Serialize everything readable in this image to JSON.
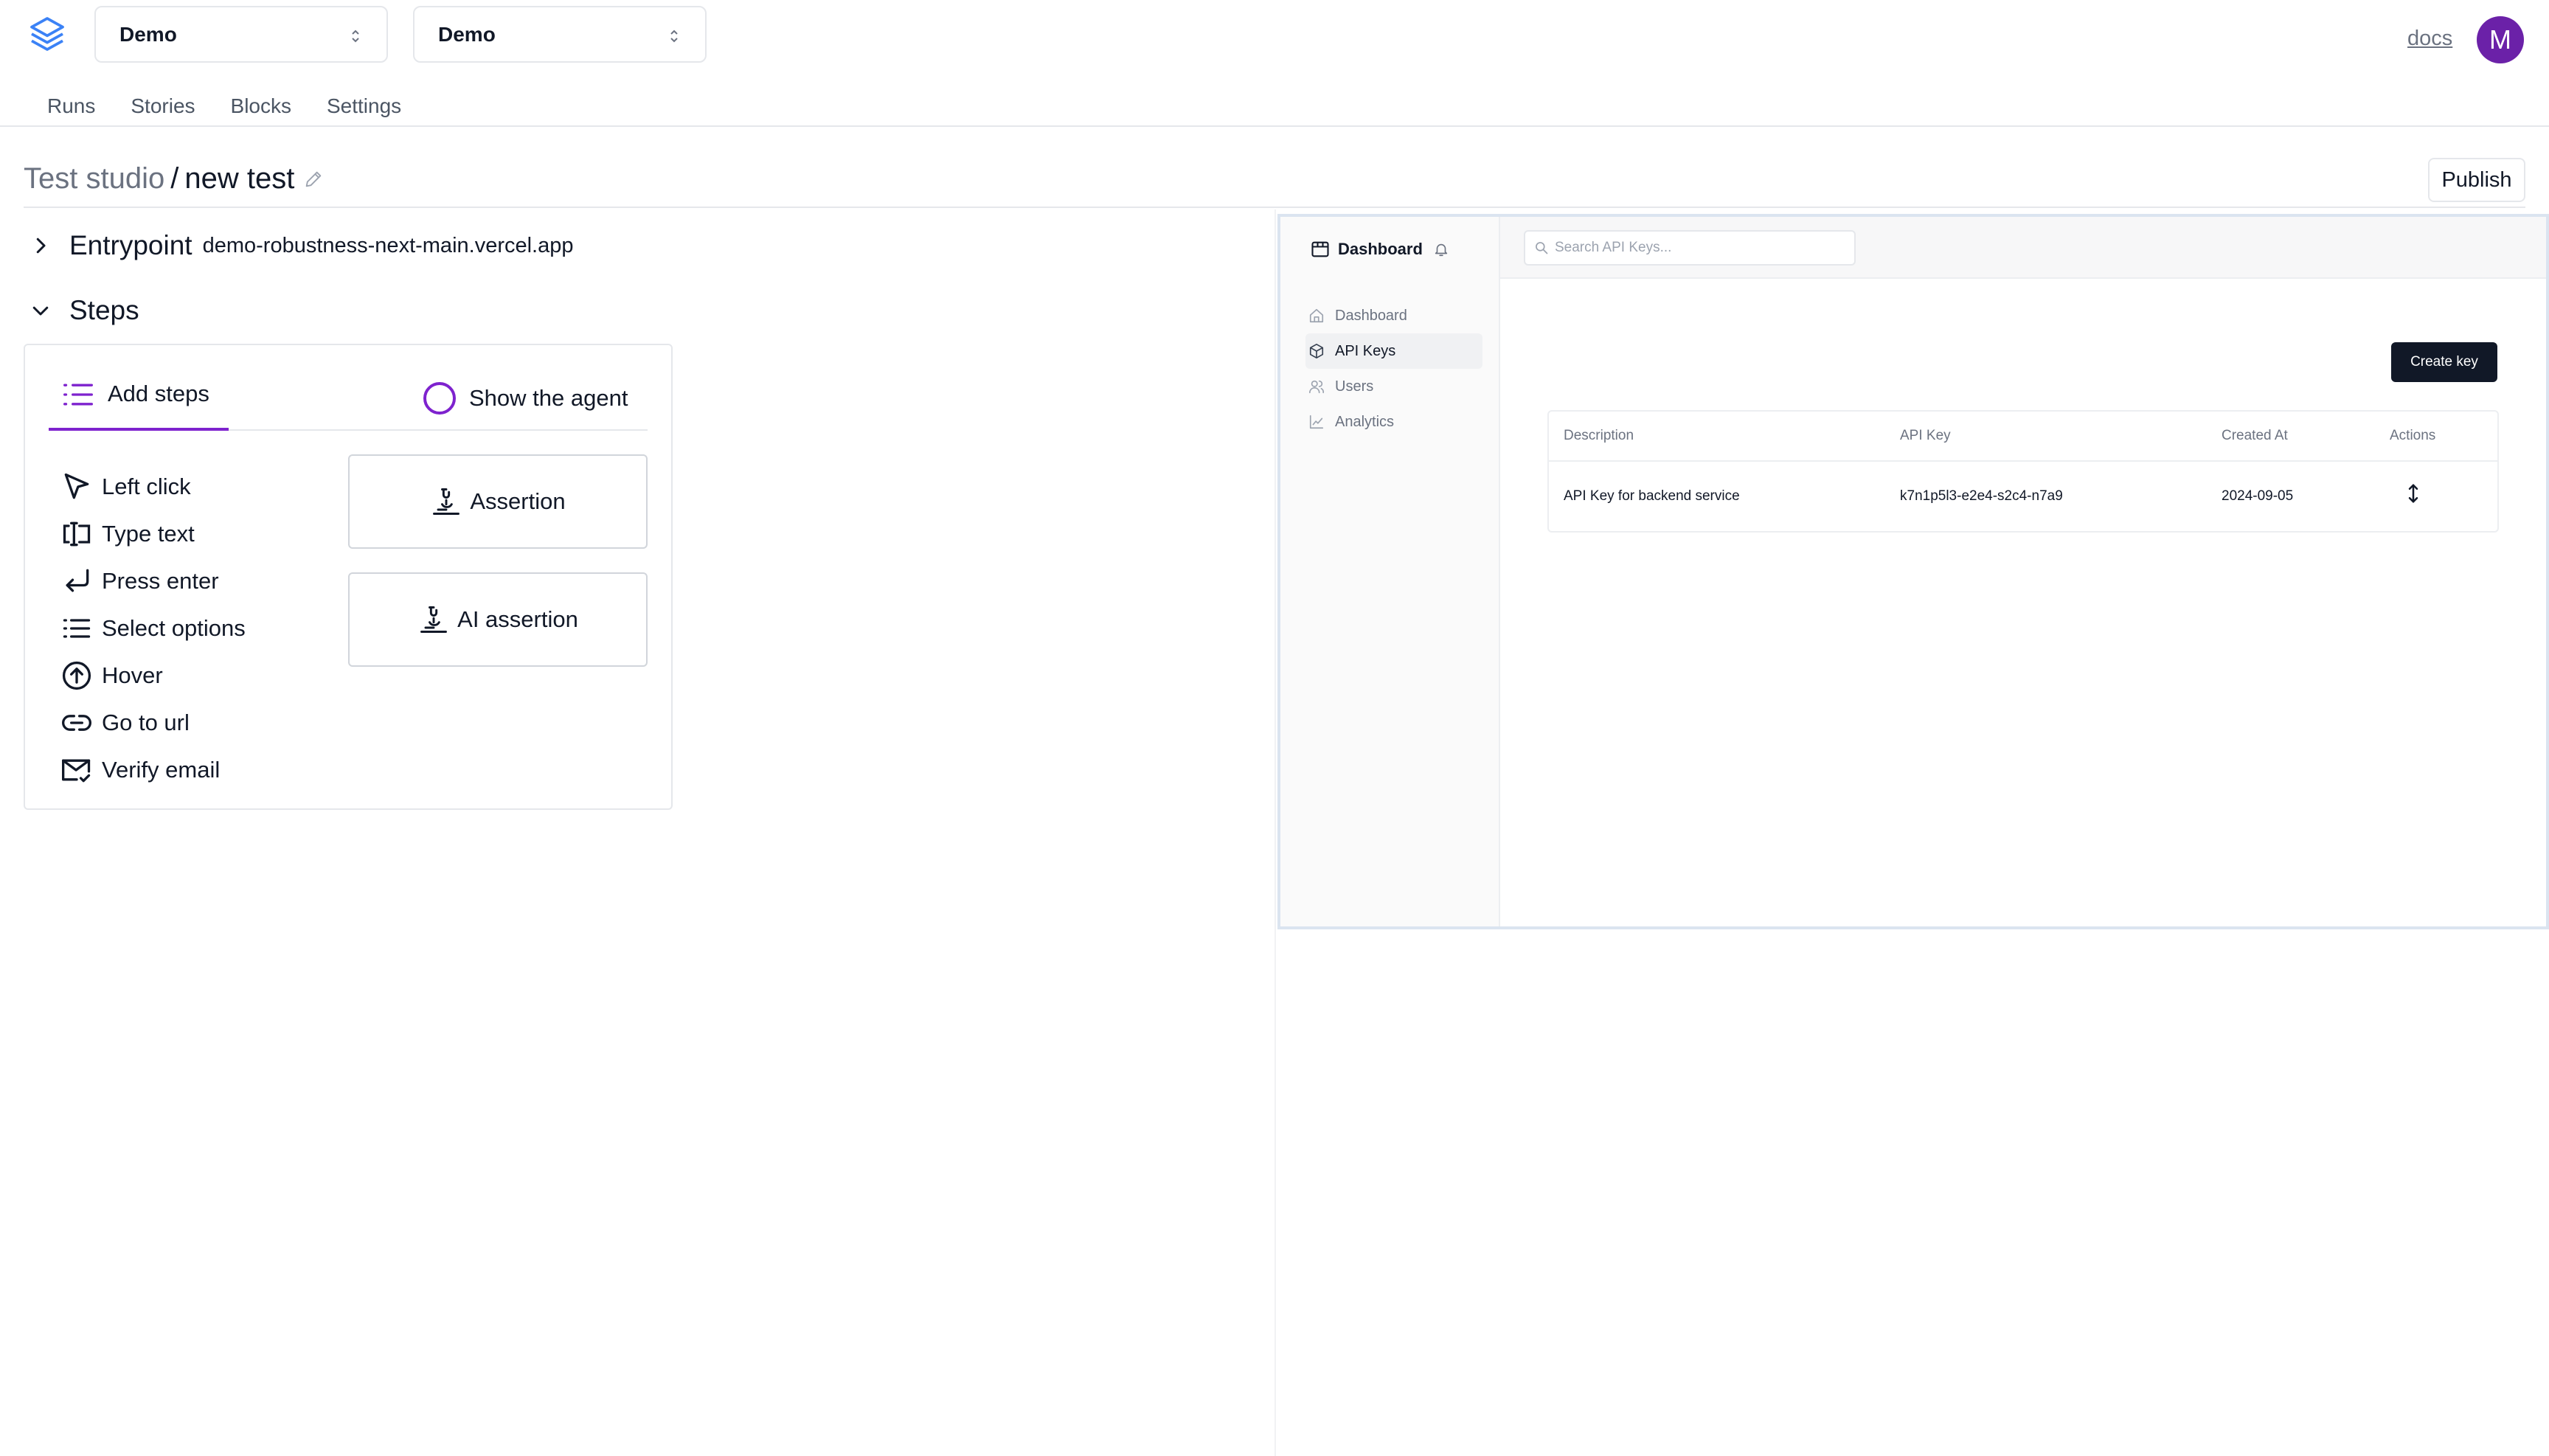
{
  "header": {
    "project_select": "Demo",
    "env_select": "Demo",
    "docs_label": "docs",
    "avatar_initial": "M",
    "nav": [
      "Runs",
      "Stories",
      "Blocks",
      "Settings"
    ]
  },
  "page": {
    "breadcrumb_parent": "Test studio",
    "breadcrumb_sep": "/",
    "title": "new test",
    "publish_label": "Publish"
  },
  "entrypoint": {
    "label": "Entrypoint",
    "url": "demo-robustness-next-main.vercel.app"
  },
  "steps": {
    "label": "Steps",
    "tab_add": "Add steps",
    "tab_agent": "Show the agent",
    "items": [
      {
        "label": "Left click",
        "icon": "cursor-icon"
      },
      {
        "label": "Type text",
        "icon": "text-cursor-icon"
      },
      {
        "label": "Press enter",
        "icon": "enter-icon"
      },
      {
        "label": "Select options",
        "icon": "list-icon"
      },
      {
        "label": "Hover",
        "icon": "arrow-up-circle-icon"
      },
      {
        "label": "Go to url",
        "icon": "link-icon"
      },
      {
        "label": "Verify email",
        "icon": "mail-check-icon"
      }
    ],
    "assertion_label": "Assertion",
    "ai_assertion_label": "AI assertion"
  },
  "preview": {
    "brand": "Dashboard",
    "search_placeholder": "Search API Keys...",
    "nav": [
      {
        "label": "Dashboard",
        "icon": "home-icon",
        "active": false
      },
      {
        "label": "API Keys",
        "icon": "package-icon",
        "active": true
      },
      {
        "label": "Users",
        "icon": "users-icon",
        "active": false
      },
      {
        "label": "Analytics",
        "icon": "chart-icon",
        "active": false
      }
    ],
    "create_label": "Create key",
    "table": {
      "headers": [
        "Description",
        "API Key",
        "Created At",
        "Actions"
      ],
      "row": [
        "API Key for backend service",
        "k7n1p5l3-e2e4-s2c4-n7a9",
        "2024-09-05"
      ]
    }
  },
  "colors": {
    "accent": "#7e22ce",
    "avatar": "#6b21a8",
    "logo": "#3b82f6",
    "create_button": "#111827"
  }
}
